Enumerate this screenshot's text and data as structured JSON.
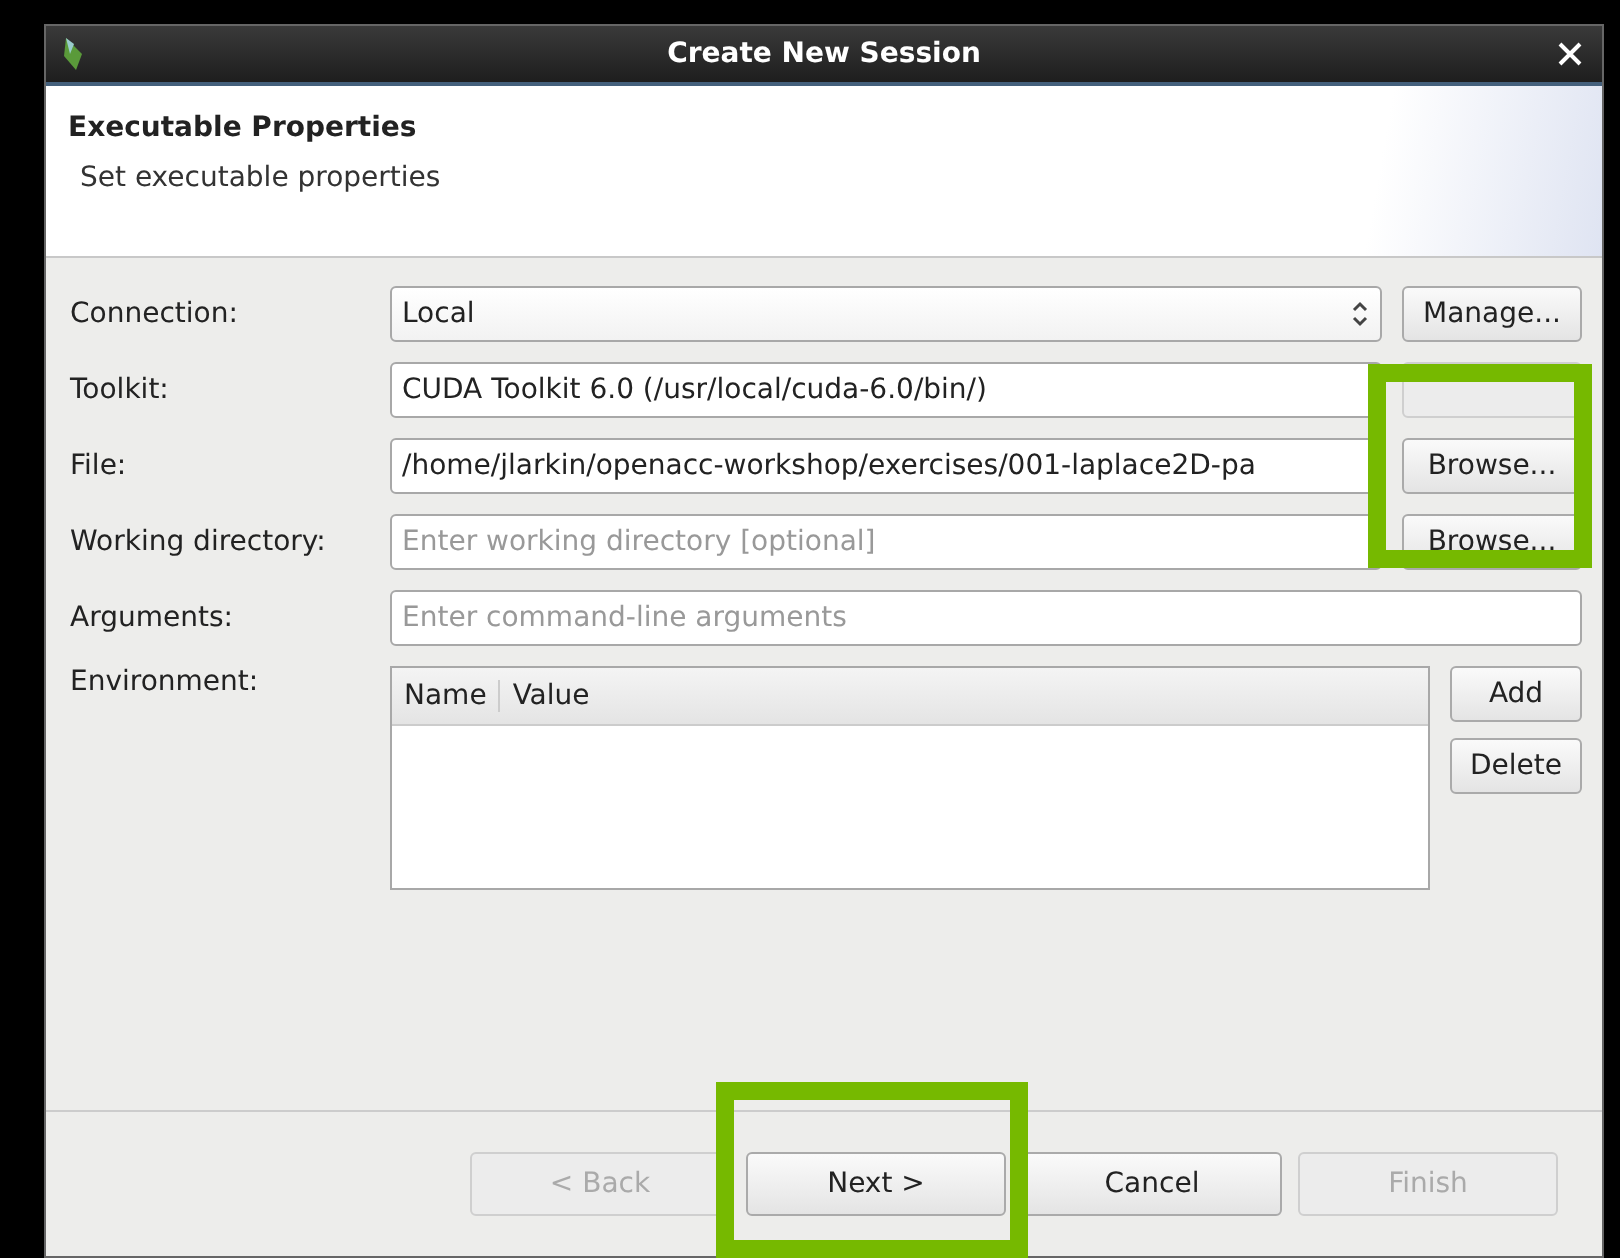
{
  "window": {
    "title": "Create New Session"
  },
  "header": {
    "title": "Executable Properties",
    "subtitle": "Set executable properties"
  },
  "fields": [
    {
      "label": "Connection:",
      "kind": "combo",
      "value": "Local",
      "button": {
        "label": "Manage...",
        "disabled": false
      }
    },
    {
      "label": "Toolkit:",
      "kind": "text",
      "value": "CUDA Toolkit 6.0 (/usr/local/cuda-6.0/bin/)",
      "button": {
        "disabled": true
      }
    },
    {
      "label": "File:",
      "kind": "text",
      "value": "/home/jlarkin/openacc-workshop/exercises/001-laplace2D-pa",
      "button": {
        "label": "Browse...",
        "disabled": false
      }
    },
    {
      "label": "Working directory:",
      "kind": "text",
      "placeholder": "Enter working directory [optional]",
      "button": {
        "label": "Browse...",
        "disabled": false
      }
    },
    {
      "label": "Arguments:",
      "kind": "text",
      "placeholder": "Enter command-line arguments"
    }
  ],
  "environment": {
    "label": "Environment:",
    "columns": [
      "Name",
      "Value"
    ],
    "buttons": [
      "Add",
      "Delete"
    ]
  },
  "wizard_buttons": [
    {
      "label": "< Back",
      "disabled": true
    },
    {
      "label": "Next >",
      "disabled": false
    },
    {
      "label": "Cancel",
      "disabled": false
    },
    {
      "label": "Finish",
      "disabled": true
    }
  ],
  "annotations": [
    {
      "kind": "frame"
    },
    {
      "kind": "frame"
    }
  ]
}
